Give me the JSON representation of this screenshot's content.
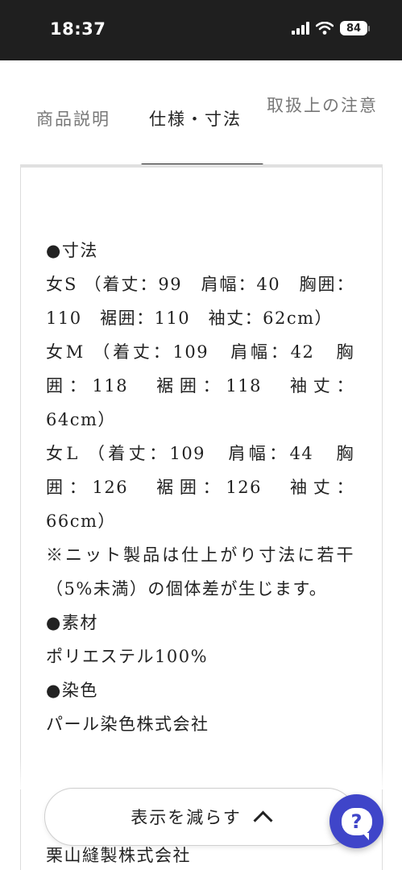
{
  "status_bar": {
    "time": "18:37",
    "battery": "84",
    "icons": [
      "signal-icon",
      "wifi-icon",
      "battery-icon"
    ]
  },
  "tabs": [
    {
      "label": "商品説明",
      "active": false
    },
    {
      "label": "仕様・寸法",
      "active": true
    },
    {
      "label": "取扱上の注意",
      "active": false
    }
  ],
  "content": {
    "lines": [
      "●寸法",
      "女S （着丈：99　肩幅：40　胸囲：110　裾囲：110　袖丈：62cm）",
      "女M （着丈：109　肩幅：42　胸囲：118　裾囲：118　袖丈：64cm）",
      "女L （着丈：109　肩幅：44　胸囲：126　裾囲：126　袖丈：66cm）",
      "※ニット製品は仕上がり寸法に若干（5%未満）の個体差が生じます。",
      "●素材",
      "ポリエステル100%",
      "●染色",
      "パール染色株式会社",
      "栗山縫製株式会社"
    ]
  },
  "show_less_label": "表示を減らす",
  "colors": {
    "accent": "#3f45c9",
    "status_bar": "#1f1f1f",
    "tab_active": "#222222",
    "tab_inactive": "#777777"
  }
}
